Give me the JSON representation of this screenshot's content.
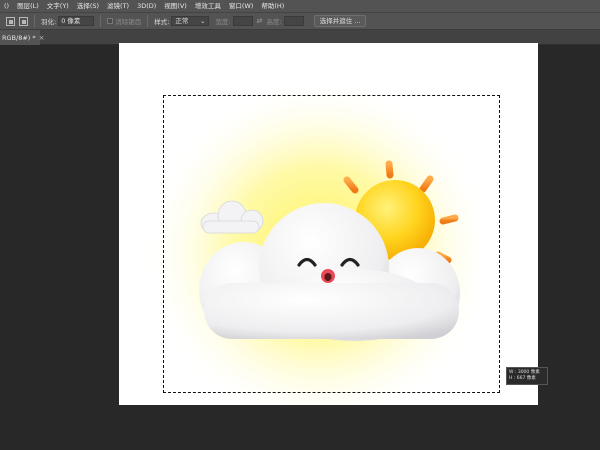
{
  "menubar": {
    "items": [
      "()",
      "图层(L)",
      "文字(Y)",
      "选择(S)",
      "滤镜(T)",
      "3D(D)",
      "视图(V)",
      "增效工具",
      "窗口(W)",
      "帮助(H)"
    ]
  },
  "options": {
    "feather_label": "羽化:",
    "feather_value": "0 像素",
    "antialias_label": "消除锯齿",
    "style_label": "样式:",
    "style_value": "正常",
    "width_label": "宽度:",
    "height_label": "高度:",
    "select_mask_label": "选择并遮住 ..."
  },
  "document": {
    "tab_title": "RGB/8#) *",
    "close_icon": "×"
  },
  "illustration": {
    "icon": "weather-sun-behind-cloud-3d",
    "colors": {
      "sun": "#ffd21f",
      "rays": "#ff8a2a",
      "cloud": "#f4f4f6",
      "glow": "#fff46a",
      "mouth": "#e84a5a"
    }
  },
  "tooltip": {
    "w_line": "W : 3000 像素",
    "h_line": "H : 667 像素"
  }
}
